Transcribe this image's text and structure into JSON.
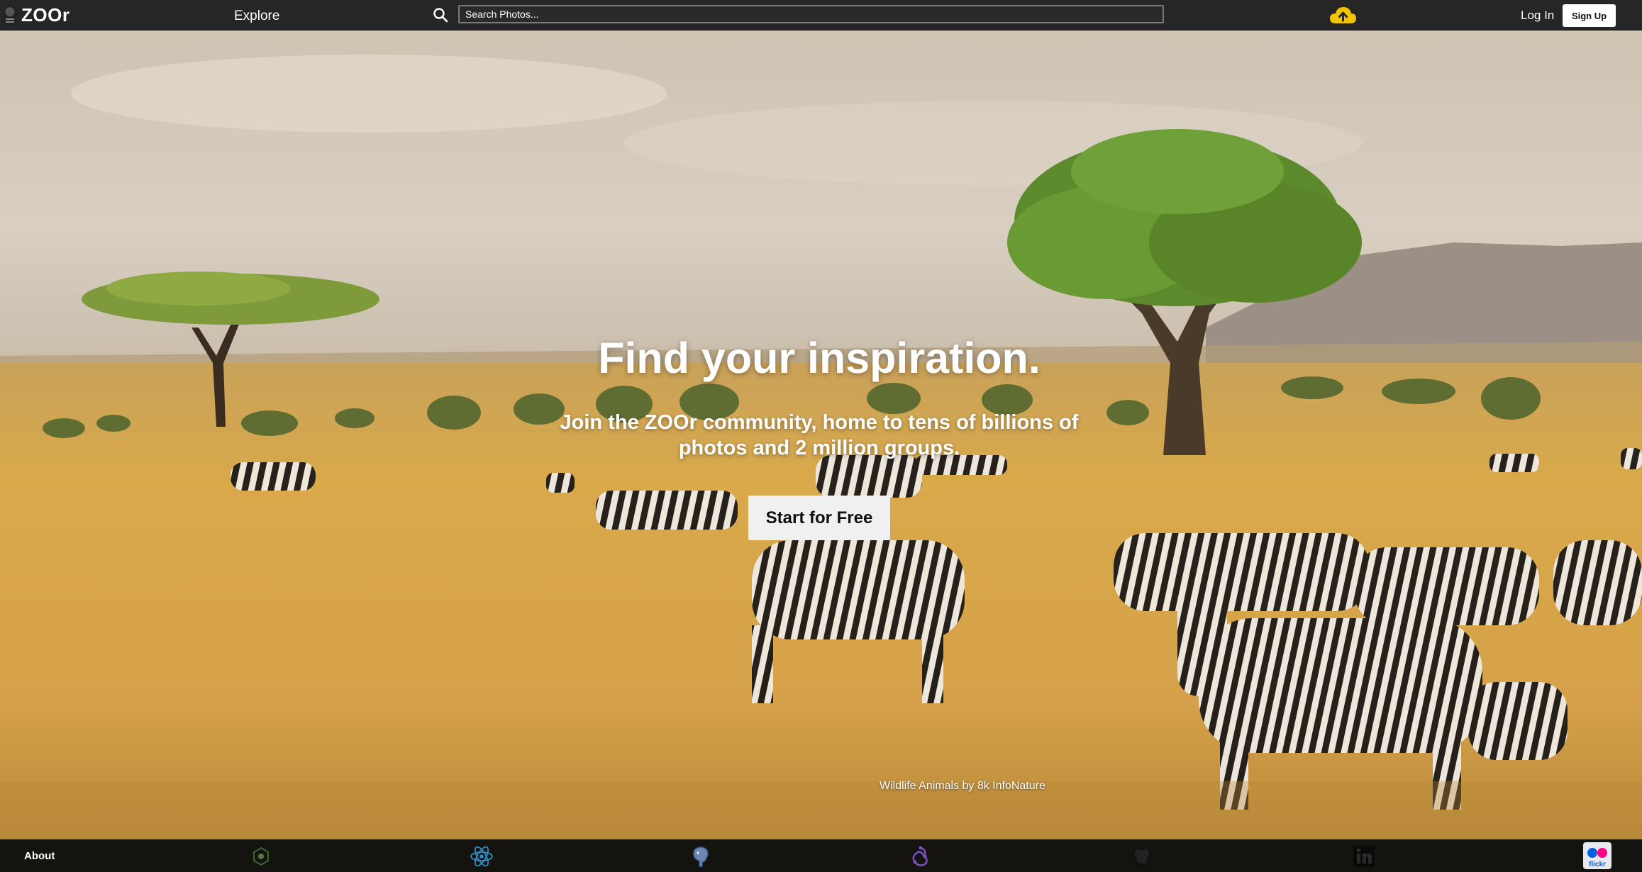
{
  "nav": {
    "logo_text": "ZOOr",
    "explore_label": "Explore",
    "search_placeholder": "Search Photos...",
    "login_label": "Log In",
    "signup_label": "Sign Up",
    "upload_icon": "cloud-upload-icon",
    "upload_color": "#f2c400"
  },
  "hero": {
    "title": "Find your inspiration.",
    "subtitle": "Join the ZOOr community, home to tens of billions of photos and 2 million groups.",
    "cta_label": "Start for Free",
    "credit": "Wildlife Animals by 8k InfoNature"
  },
  "footer": {
    "about_label": "About",
    "tech_icons": [
      "node-icon",
      "react-icon",
      "postgresql-icon",
      "redux-icon",
      "github-icon",
      "linkedin-icon",
      "flickr-icon"
    ],
    "flickr_label": "flickr"
  },
  "colors": {
    "nav_bg": "#262626",
    "footer_bg": "#14120e",
    "cta_bg": "#f0f0f0"
  }
}
